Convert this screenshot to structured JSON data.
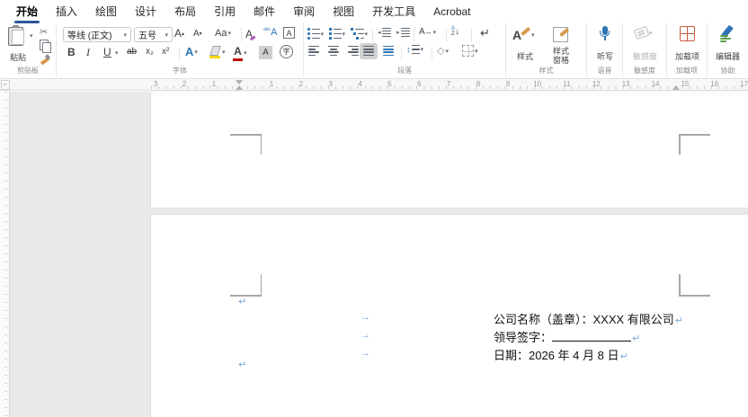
{
  "tabbar": {
    "tabs": [
      {
        "label": "开始",
        "active": true
      },
      {
        "label": "插入",
        "active": false
      },
      {
        "label": "绘图",
        "active": false
      },
      {
        "label": "设计",
        "active": false
      },
      {
        "label": "布局",
        "active": false
      },
      {
        "label": "引用",
        "active": false
      },
      {
        "label": "邮件",
        "active": false
      },
      {
        "label": "审阅",
        "active": false
      },
      {
        "label": "视图",
        "active": false
      },
      {
        "label": "开发工具",
        "active": false
      },
      {
        "label": "Acrobat",
        "active": false
      }
    ]
  },
  "ribbon": {
    "clipboard": {
      "paste": "粘贴",
      "group": "剪贴板"
    },
    "font": {
      "font_name": "等线 (正文)",
      "font_size": "五号",
      "group": "字体",
      "grow": "A",
      "shrink": "A",
      "case": "Aa",
      "clear": "A",
      "phonetic_small": "abc",
      "phonetic_a": "A",
      "char_border": "A",
      "bold": "B",
      "italic": "I",
      "underline": "U",
      "strike": "ab",
      "subscript": "x₂",
      "superscript": "x²",
      "effects": "A",
      "font_color": "A",
      "char_shade": "A",
      "enclose": "字"
    },
    "paragraph": {
      "group": "段落",
      "scale": "A",
      "sort_a": "A",
      "sort_z": "Z",
      "sort_arrow": "↓",
      "marks": "↵",
      "spacing": "↕",
      "bucket": "◇"
    },
    "styles": {
      "styles": "样式",
      "pane_line1": "样式",
      "pane_line2": "窗格",
      "group": "样式"
    },
    "voice": {
      "dictate": "听写",
      "group": "语音"
    },
    "sensitivity": {
      "label": "敏感度",
      "group": "敏感度"
    },
    "addins": {
      "label": "加载项",
      "group": "加载项"
    },
    "editor": {
      "label": "编辑器",
      "group": "协助"
    }
  },
  "icons": {
    "dropdown": "▾",
    "scissors": "✂",
    "up": "▴",
    "down": "▾",
    "arrow_lr": "↔",
    "indent_l": "◂",
    "indent_r": "▸",
    "tab_selector": "⌐"
  },
  "ruler": {
    "left_numbers": [
      "3",
      "2",
      "1"
    ],
    "numbers": [
      "1",
      "2",
      "3",
      "4",
      "5",
      "6",
      "7",
      "8",
      "9",
      "10",
      "11",
      "12",
      "13",
      "14",
      "15",
      "16",
      "17"
    ]
  },
  "document": {
    "tab_mark": "→",
    "para_mark": "↵",
    "lines": [
      {
        "text": "公司名称（盖章）：XXXX 有限公司",
        "blank": false
      },
      {
        "text": "领导签字：",
        "blank": true
      },
      {
        "text": "日期：2026 年 4 月 8 日",
        "blank": false
      }
    ]
  },
  "colors": {
    "accent_blue": "#2b579a",
    "icon_blue": "#2e75b6",
    "marks_blue": "#7aa9d8",
    "addin_red": "#c75b39",
    "highlight_yellow": "#f5d800",
    "font_color_red": "#c00000"
  }
}
